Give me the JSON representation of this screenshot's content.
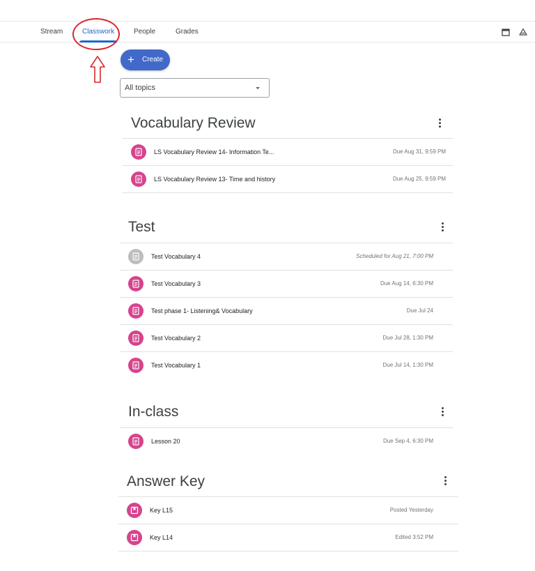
{
  "nav": {
    "tabs": [
      "Stream",
      "Classwork",
      "People",
      "Grades"
    ],
    "active_tab": "Classwork",
    "icons": [
      "calendar-icon",
      "drive-icon"
    ]
  },
  "create_button": {
    "label": "Create",
    "icon": "plus-icon"
  },
  "topic_filter": {
    "selected": "All topics"
  },
  "colors": {
    "accent": "#1967d2",
    "create_button": "#4169c9",
    "assignment_badge": "#d6448d",
    "scheduled_badge": "#bdbdbd",
    "annotation": "#d9262e"
  },
  "topics": [
    {
      "title": "Vocabulary Review",
      "items": [
        {
          "title": "LS Vocabulary Review 14- Information Te...",
          "status": "Due Aug 31, 9:59 PM",
          "type": "assignment"
        },
        {
          "title": "LS Vocabulary Review 13- Time and history",
          "status": "Due Aug 25, 9:59 PM",
          "type": "assignment"
        }
      ]
    },
    {
      "title": "Test",
      "items": [
        {
          "title": "Test Vocabulary 4",
          "status": "Scheduled for Aug 21, 7:00 PM",
          "type": "scheduled"
        },
        {
          "title": "Test Vocabulary 3",
          "status": "Due Aug 14, 6:30 PM",
          "type": "assignment"
        },
        {
          "title": "Test phase 1- Listening& Vocabulary",
          "status": "Due Jul 24",
          "type": "assignment"
        },
        {
          "title": "Test Vocabulary 2",
          "status": "Due Jul 28, 1:30 PM",
          "type": "assignment"
        },
        {
          "title": "Test Vocabulary 1",
          "status": "Due Jul 14, 1:30 PM",
          "type": "assignment"
        }
      ]
    },
    {
      "title": "In-class",
      "items": [
        {
          "title": "Lesson 20",
          "status": "Due Sep 4, 6:30 PM",
          "type": "assignment"
        }
      ]
    },
    {
      "title": "Answer Key",
      "items": [
        {
          "title": "Key L15",
          "status": "Posted Yesterday",
          "type": "material"
        },
        {
          "title": "Key L14",
          "status": "Edited 3:52 PM",
          "type": "material"
        }
      ]
    }
  ]
}
